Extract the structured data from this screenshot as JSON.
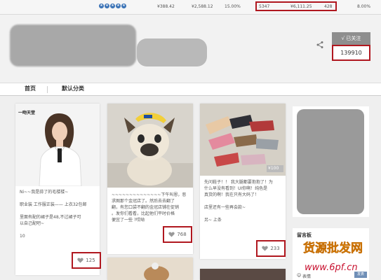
{
  "stats_bar": {
    "stars_count": 5,
    "values": [
      "¥388.42",
      "¥2,588.12",
      "15.00%",
      "5347",
      "¥6,111.25",
      "428",
      "8.00%"
    ]
  },
  "follow": {
    "button_label": "√ 已关注",
    "count": "139910"
  },
  "tabs": [
    {
      "label": "首页"
    },
    {
      "label": "默认分类"
    }
  ],
  "cards": [
    {
      "brand_label": "一吻天堂",
      "text_lines": [
        "Ni~~我是蒜了的毛楼楼~",
        "",
        "职业装 工作服正装—— 上衣32包邮",
        "",
        "里面有配的裙子是48,不过裙子可",
        "以自己配吧~",
        "",
        "10"
      ],
      "likes": "125"
    },
    {
      "text_lines": [
        "~~~~~~~~~~~~~~下午叫恩，恶",
        "求图那个金冠店了。然后去去翻了",
        "翻，有您口袋不翻的金冠店铺在促销",
        "。发你们看看，比起他们平时价格",
        "便宜了一些 ?哎呦"
      ],
      "likes": "768"
    },
    {
      "photo_tag": "¥100",
      "text_lines": [
        "先问鞋子！！ 我大腿都要抱抱了！为",
        "什么早没有看到！UI你啊！纯色是",
        "真货的啊！我在只有大码了！",
        "",
        "店里还有一些再会款~",
        "",
        "另~ 上条"
      ],
      "likes": "233"
    }
  ],
  "message_board": {
    "title": "留言板",
    "emoji_label": "表情",
    "publish_label": "发表"
  },
  "watermark": {
    "text": "货源批发网",
    "url": "www.6pf.cn"
  },
  "colors": {
    "highlight_border": "#b0171f",
    "follow_button": "#8e8e8e",
    "star_blue": "#3b73b6"
  }
}
